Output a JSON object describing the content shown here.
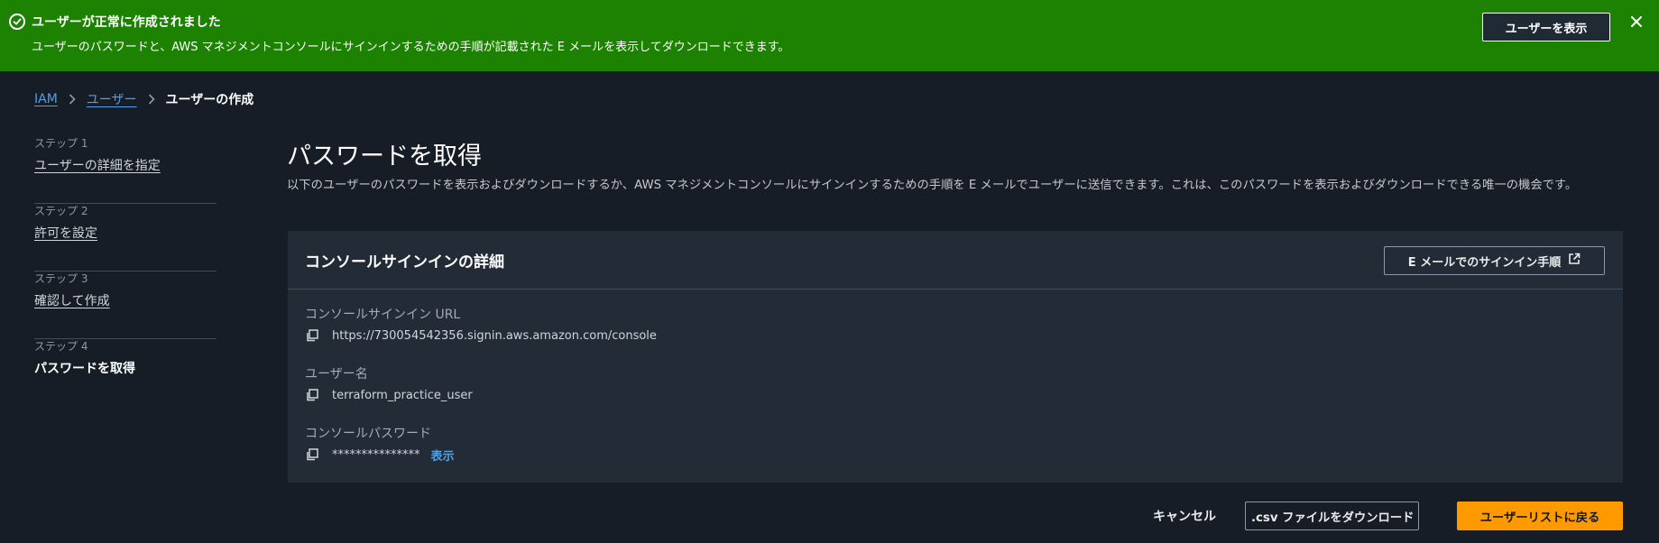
{
  "banner": {
    "title": "ユーザーが正常に作成されました",
    "description": "ユーザーのパスワードと、AWS マネジメントコンソールにサインインするための手順が記載された E メールを表示してダウンロードできます。",
    "view_user_button": "ユーザーを表示",
    "status_icon": "success-check-icon",
    "close_icon": "close-icon",
    "color": "#1d8102"
  },
  "breadcrumb": {
    "items": [
      "IAM",
      "ユーザー",
      "ユーザーの作成"
    ]
  },
  "steps": [
    {
      "number": "ステップ 1",
      "label": "ユーザーの詳細を指定"
    },
    {
      "number": "ステップ 2",
      "label": "許可を設定"
    },
    {
      "number": "ステップ 3",
      "label": "確認して作成"
    },
    {
      "number": "ステップ 4",
      "label": "パスワードを取得"
    }
  ],
  "main": {
    "title": "パスワードを取得",
    "description": "以下のユーザーのパスワードを表示およびダウンロードするか、AWS マネジメントコンソールにサインインするための手順を E メールでユーザーに送信できます。これは、このパスワードを表示およびダウンロードできる唯一の機会です。"
  },
  "panel": {
    "title": "コンソールサインインの詳細",
    "email_button": "E メールでのサインイン手順",
    "fields": [
      {
        "label": "コンソールサインイン URL",
        "value": "https://730054542356.signin.aws.amazon.com/console"
      },
      {
        "label": "ユーザー名",
        "value": "terraform_practice_user"
      },
      {
        "label": "コンソールパスワード",
        "value": "***************",
        "action": "表示"
      }
    ]
  },
  "footer": {
    "cancel": "キャンセル",
    "download_csv": ".csv ファイルをダウンロード",
    "return": "ユーザーリストに戻る"
  },
  "colors": {
    "background": "#161d26",
    "link": "#539fe5",
    "primary": "#ff9900"
  }
}
